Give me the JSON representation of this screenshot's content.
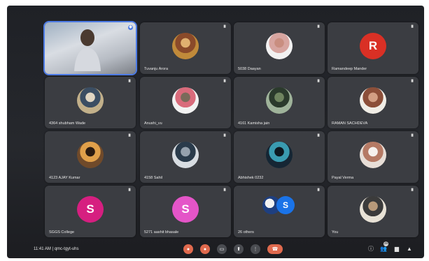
{
  "meeting": {
    "time": "11:41 AM",
    "separator": "|",
    "code": "qmc-tgyt-uhs"
  },
  "participants": [
    {
      "name": "",
      "type": "camera"
    },
    {
      "name": "Tuvanju Arora",
      "type": "photo",
      "palette": [
        "#c08a3a",
        "#8a4a2a",
        "#e0b070"
      ]
    },
    {
      "name": "5038 Daayan",
      "type": "photo",
      "palette": [
        "#f2f2f2",
        "#d7a5a0",
        "#c98e80"
      ]
    },
    {
      "name": "Ramandeep Mander",
      "type": "letter",
      "letter": "R",
      "color": "#d93025"
    },
    {
      "name": "4364 shubham Wade",
      "type": "photo",
      "palette": [
        "#c2b08a",
        "#3b4e63",
        "#e0d6c3"
      ]
    },
    {
      "name": "Anushi_vu",
      "type": "photo",
      "palette": [
        "#f2f2f2",
        "#d96b7b",
        "#7a6a5a"
      ]
    },
    {
      "name": "4161 Kamisha jain",
      "type": "photo",
      "palette": [
        "#9fb39a",
        "#2b3a2c",
        "#6f845f"
      ]
    },
    {
      "name": "RAMAN SACHDEVA",
      "type": "photo",
      "palette": [
        "#f0ede6",
        "#8c4f39",
        "#d29f84"
      ]
    },
    {
      "name": "4123 AJAY Kumar",
      "type": "photo",
      "palette": [
        "#704a2a",
        "#e0a04a",
        "#2b1b10"
      ]
    },
    {
      "name": "4158 Sahil",
      "type": "photo",
      "palette": [
        "#d8dde2",
        "#2a3b4b",
        "#95a1ad"
      ]
    },
    {
      "name": "Abhishek 0232",
      "type": "photo",
      "palette": [
        "#152634",
        "#3a9bb0",
        "#0d1820"
      ]
    },
    {
      "name": "Payal Verma",
      "type": "photo",
      "palette": [
        "#e7ded7",
        "#b57a65",
        "#f6f1ee"
      ]
    },
    {
      "name": "SGGS College",
      "type": "letter",
      "letter": "S",
      "color": "#d61f80"
    },
    {
      "name": "5271 aashit bhasale",
      "type": "letter",
      "letter": "S",
      "color": "#e455c8"
    },
    {
      "name": "26 others",
      "type": "others",
      "letter": "S",
      "color": "#1a73e8"
    },
    {
      "name": "You",
      "type": "photo",
      "palette": [
        "#e8e2d6",
        "#3b3b3b",
        "#b89a7a"
      ]
    }
  ],
  "controls": [
    {
      "name": "mic-off-button",
      "icon": "mic-off-icon",
      "glyph": "●",
      "style": "red"
    },
    {
      "name": "camera-off-button",
      "icon": "camera-off-icon",
      "glyph": "●",
      "style": "red"
    },
    {
      "name": "captions-button",
      "icon": "captions-icon",
      "glyph": "▭",
      "style": "gray"
    },
    {
      "name": "present-button",
      "icon": "present-icon",
      "glyph": "⬆",
      "style": "gray"
    },
    {
      "name": "more-options-button",
      "icon": "more-vert-icon",
      "glyph": "⋮",
      "style": "gray"
    },
    {
      "name": "leave-call-button",
      "icon": "hangup-icon",
      "glyph": "☎",
      "style": "end"
    }
  ],
  "right_icons": [
    {
      "name": "info-button",
      "icon": "info-icon",
      "glyph": "ⓘ"
    },
    {
      "name": "people-button",
      "icon": "people-icon",
      "glyph": "👥",
      "badge": "36"
    },
    {
      "name": "chat-button",
      "icon": "chat-icon",
      "glyph": "▆"
    },
    {
      "name": "activities-button",
      "icon": "activities-icon",
      "glyph": "▲"
    }
  ]
}
